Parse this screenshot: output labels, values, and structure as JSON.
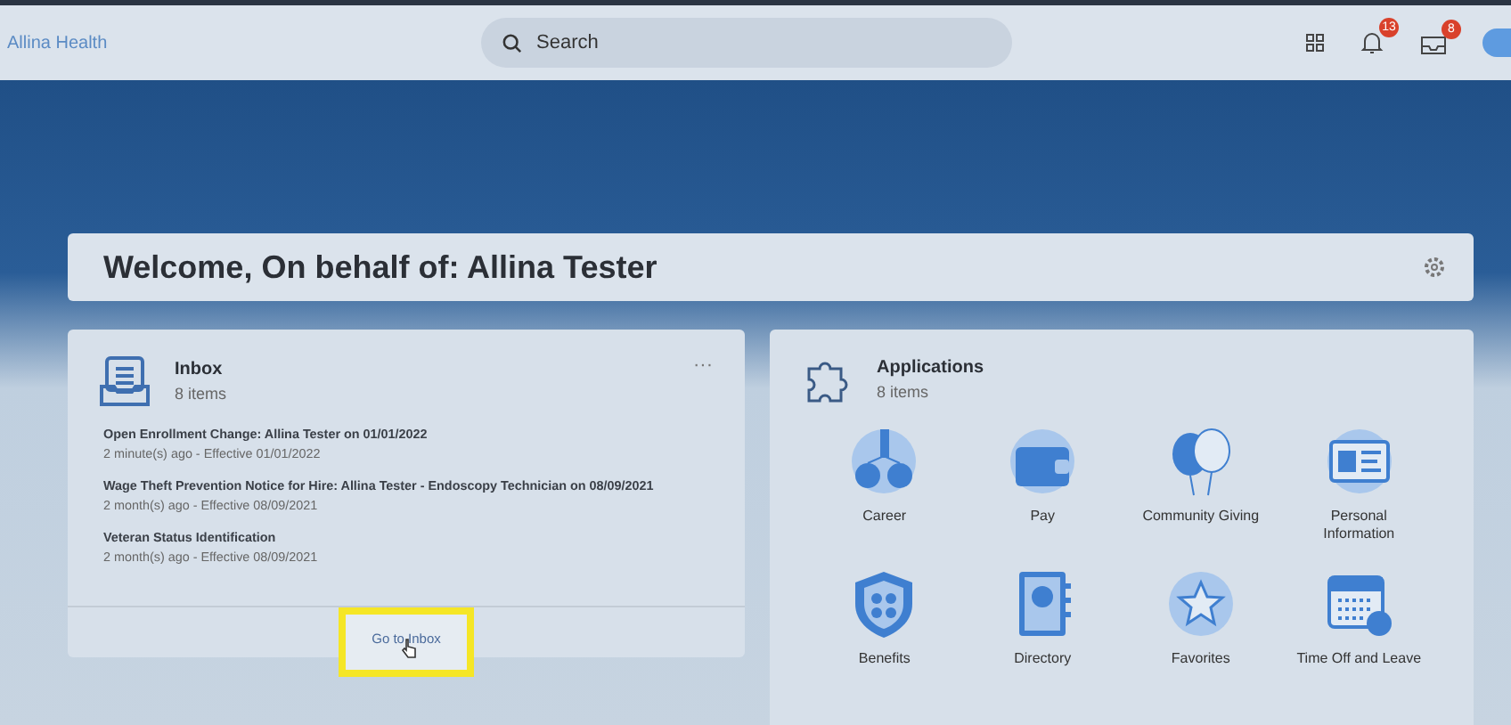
{
  "header": {
    "logo": "Allina Health",
    "search": {
      "placeholder": "Search"
    },
    "notifications_badge": "13",
    "inbox_badge": "8"
  },
  "welcome": {
    "title": "Welcome, On behalf of: Allina Tester"
  },
  "inbox": {
    "title": "Inbox",
    "count": "8 items",
    "more": "···",
    "items": [
      {
        "title": "Open Enrollment Change: Allina Tester on 01/01/2022",
        "meta": "2 minute(s) ago - Effective 01/01/2022"
      },
      {
        "title": "Wage Theft Prevention Notice for Hire: Allina Tester - Endoscopy Technician on 08/09/2021",
        "meta": "2 month(s) ago - Effective 08/09/2021"
      },
      {
        "title": "Veteran Status Identification",
        "meta": "2 month(s) ago - Effective 08/09/2021"
      }
    ],
    "link": "Go to Inbox",
    "highlighted": true
  },
  "applications": {
    "title": "Applications",
    "count": "8 items",
    "apps": [
      {
        "label": "Career"
      },
      {
        "label": "Pay"
      },
      {
        "label": "Community Giving"
      },
      {
        "label": "Personal Information"
      },
      {
        "label": "Benefits"
      },
      {
        "label": "Directory"
      },
      {
        "label": "Favorites"
      },
      {
        "label": "Time Off and Leave"
      }
    ]
  }
}
